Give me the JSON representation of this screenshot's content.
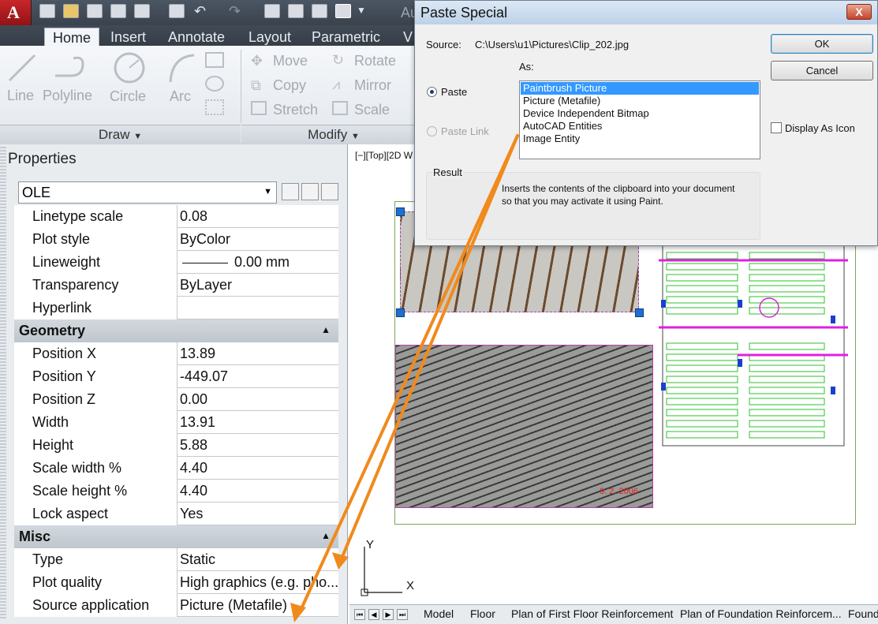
{
  "qat": {
    "app_button_label": "A",
    "title_fragment": "Au",
    "icons": [
      "new-icon",
      "open-icon",
      "save-icon",
      "saveas-icon",
      "plot-icon",
      "print-icon",
      "undo-icon",
      "redo-icon",
      "share-icon",
      "publish-icon",
      "plot-preview-icon",
      "dropdown-icon"
    ]
  },
  "ribbon": {
    "tabs": [
      "Home",
      "Insert",
      "Annotate",
      "Layout",
      "Parametric",
      "V"
    ],
    "active_tab": "Home",
    "draw_tools": [
      "Line",
      "Polyline",
      "Circle",
      "Arc"
    ],
    "modify_tools": [
      "Move",
      "Rotate",
      "Copy",
      "Mirror",
      "Stretch",
      "Scale"
    ],
    "panels": {
      "draw": "Draw",
      "modify": "Modify"
    }
  },
  "properties": {
    "title": "Properties",
    "selected_object": "OLE",
    "rows_top": [
      {
        "key": "Linetype scale",
        "value": "0.08"
      },
      {
        "key": "Plot style",
        "value": "ByColor"
      },
      {
        "key": "Lineweight",
        "value": "0.00 mm"
      },
      {
        "key": "Transparency",
        "value": "ByLayer"
      },
      {
        "key": "Hyperlink",
        "value": ""
      }
    ],
    "geometry_header": "Geometry",
    "geometry": [
      {
        "key": "Position X",
        "value": "13.89"
      },
      {
        "key": "Position Y",
        "value": "-449.07"
      },
      {
        "key": "Position Z",
        "value": "0.00"
      },
      {
        "key": "Width",
        "value": "13.91"
      },
      {
        "key": "Height",
        "value": "5.88"
      },
      {
        "key": "Scale width  %",
        "value": "4.40"
      },
      {
        "key": "Scale height %",
        "value": "4.40"
      },
      {
        "key": "Lock aspect",
        "value": "Yes"
      }
    ],
    "misc_header": "Misc",
    "misc": [
      {
        "key": "Type",
        "value": "Static"
      },
      {
        "key": "Plot quality",
        "value": "High graphics (e.g. pho..."
      },
      {
        "key": "Source application",
        "value": "Picture (Metafile)"
      }
    ]
  },
  "viewport": {
    "label": "[−][Top][2D W",
    "ucs_y": "Y",
    "ucs_x": "X",
    "photo_stamp": "9. 2. 2006"
  },
  "layout_tabs": [
    "Model",
    "Floor",
    "Plan of First Floor Reinforcement",
    "Plan of Foundation Reinforcem...",
    "Found"
  ],
  "dialog": {
    "title": "Paste Special",
    "close_label": "X",
    "source_label": "Source:",
    "source_value": "C:\\Users\\u1\\Pictures\\Clip_202.jpg",
    "as_label": "As:",
    "paste_label": "Paste",
    "paste_link_label": "Paste Link",
    "as_options": [
      "Paintbrush Picture",
      "Picture (Metafile)",
      "Device Independent Bitmap",
      "AutoCAD Entities",
      "Image Entity"
    ],
    "selected_option": "Paintbrush Picture",
    "ok_label": "OK",
    "cancel_label": "Cancel",
    "display_as_icon_label": "Display As Icon",
    "result_label": "Result",
    "result_text": "Inserts the contents of the clipboard into your document so that you may activate it using Paint."
  },
  "colors": {
    "accent_arrow": "#f08a1c",
    "selection_blue": "#3399ff",
    "plan_magenta": "#e020e0",
    "plan_green": "#2ec02e"
  }
}
